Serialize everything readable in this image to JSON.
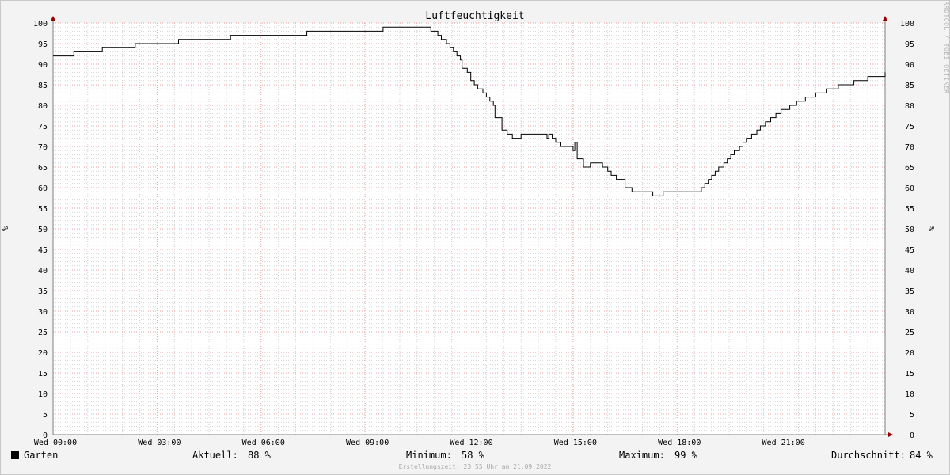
{
  "chart_data": {
    "type": "line",
    "title": "Luftfeuchtigkeit",
    "ylabel": "%",
    "ylabel_right": "%",
    "ylim": [
      0,
      100
    ],
    "yticks": [
      0,
      5,
      10,
      15,
      20,
      25,
      30,
      35,
      40,
      45,
      50,
      55,
      60,
      65,
      70,
      75,
      80,
      85,
      90,
      95,
      100
    ],
    "xlim": [
      0,
      24
    ],
    "xticks": [
      {
        "x": 0,
        "label": "Wed 00:00"
      },
      {
        "x": 3,
        "label": "Wed 03:00"
      },
      {
        "x": 6,
        "label": "Wed 06:00"
      },
      {
        "x": 9,
        "label": "Wed 09:00"
      },
      {
        "x": 12,
        "label": "Wed 12:00"
      },
      {
        "x": 15,
        "label": "Wed 15:00"
      },
      {
        "x": 18,
        "label": "Wed 18:00"
      },
      {
        "x": 21,
        "label": "Wed 21:00"
      }
    ],
    "grid": true,
    "legend_position": "bottom-left",
    "series": [
      {
        "name": "Garten",
        "color": "#000000",
        "points": [
          [
            0.0,
            92
          ],
          [
            0.58,
            92
          ],
          [
            0.6,
            93
          ],
          [
            1.4,
            93
          ],
          [
            1.42,
            94
          ],
          [
            2.35,
            94
          ],
          [
            2.37,
            95
          ],
          [
            3.6,
            95
          ],
          [
            3.62,
            96
          ],
          [
            5.1,
            96
          ],
          [
            5.12,
            97
          ],
          [
            7.3,
            97
          ],
          [
            7.32,
            98
          ],
          [
            9.5,
            98
          ],
          [
            9.52,
            99
          ],
          [
            10.8,
            99
          ],
          [
            10.9,
            98
          ],
          [
            11.1,
            97
          ],
          [
            11.2,
            96
          ],
          [
            11.35,
            95
          ],
          [
            11.45,
            94
          ],
          [
            11.55,
            93
          ],
          [
            11.65,
            92
          ],
          [
            11.75,
            91
          ],
          [
            11.8,
            89
          ],
          [
            11.95,
            88
          ],
          [
            12.05,
            86
          ],
          [
            12.15,
            85
          ],
          [
            12.25,
            84
          ],
          [
            12.4,
            83
          ],
          [
            12.5,
            82
          ],
          [
            12.6,
            81
          ],
          [
            12.7,
            80
          ],
          [
            12.75,
            77
          ],
          [
            12.9,
            77
          ],
          [
            12.95,
            74
          ],
          [
            13.1,
            73
          ],
          [
            13.25,
            72
          ],
          [
            13.45,
            72
          ],
          [
            13.5,
            73
          ],
          [
            14.2,
            73
          ],
          [
            14.25,
            72
          ],
          [
            14.3,
            73
          ],
          [
            14.4,
            72
          ],
          [
            14.5,
            71
          ],
          [
            14.65,
            70
          ],
          [
            14.95,
            70
          ],
          [
            15.0,
            69
          ],
          [
            15.05,
            71
          ],
          [
            15.12,
            67
          ],
          [
            15.2,
            67
          ],
          [
            15.3,
            65
          ],
          [
            15.45,
            65
          ],
          [
            15.5,
            66
          ],
          [
            15.75,
            66
          ],
          [
            15.85,
            65
          ],
          [
            16.0,
            64
          ],
          [
            16.1,
            63
          ],
          [
            16.25,
            62
          ],
          [
            16.45,
            62
          ],
          [
            16.5,
            60
          ],
          [
            16.6,
            60
          ],
          [
            16.7,
            59
          ],
          [
            17.25,
            59
          ],
          [
            17.3,
            58
          ],
          [
            17.55,
            58
          ],
          [
            17.6,
            59
          ],
          [
            18.6,
            59
          ],
          [
            18.7,
            60
          ],
          [
            18.8,
            61
          ],
          [
            18.9,
            62
          ],
          [
            19.0,
            63
          ],
          [
            19.1,
            64
          ],
          [
            19.2,
            65
          ],
          [
            19.35,
            66
          ],
          [
            19.45,
            67
          ],
          [
            19.55,
            68
          ],
          [
            19.65,
            69
          ],
          [
            19.8,
            70
          ],
          [
            19.9,
            71
          ],
          [
            20.0,
            72
          ],
          [
            20.15,
            73
          ],
          [
            20.3,
            74
          ],
          [
            20.4,
            75
          ],
          [
            20.55,
            76
          ],
          [
            20.7,
            77
          ],
          [
            20.85,
            78
          ],
          [
            21.0,
            79
          ],
          [
            21.25,
            80
          ],
          [
            21.45,
            81
          ],
          [
            21.7,
            82
          ],
          [
            22.0,
            83
          ],
          [
            22.3,
            84
          ],
          [
            22.65,
            85
          ],
          [
            23.1,
            86
          ],
          [
            23.5,
            87
          ],
          [
            24.0,
            88
          ]
        ]
      }
    ]
  },
  "legend": {
    "swatch_color": "#000000",
    "label": "Garten"
  },
  "stats": {
    "aktuell_label": "Aktuell:",
    "aktuell_value": "88 %",
    "minimum_label": "Minimum:",
    "minimum_value": "58 %",
    "maximum_label": "Maximum:",
    "maximum_value": "99 %",
    "durchschnitt_label": "Durchschnitt:",
    "durchschnitt_value": "84 %"
  },
  "watermark": "RRDTOOL / TOBI OETIKER",
  "footnote": "Erstellungszeit: 23:55 Uhr am 21.09.2022",
  "colors": {
    "canvas": "#ffffff",
    "background": "#f3f3f3",
    "major_grid": "#e8a0a0",
    "minor_grid": "#d2d2d2",
    "axis": "#808080",
    "arrow": "#990000"
  }
}
